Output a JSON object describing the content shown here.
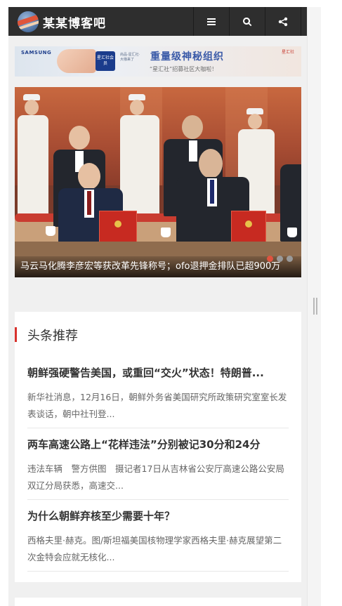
{
  "header": {
    "site_title": "某某博客吧",
    "buttons": [
      {
        "name": "menu",
        "icon": "menu-icon"
      },
      {
        "name": "search",
        "icon": "search-icon"
      },
      {
        "name": "share",
        "icon": "share-icon"
      }
    ]
  },
  "ad": {
    "brand": "SAMSUNG",
    "card_text": "星汇社会员",
    "small_text": "尚品·星汇社·大咖来了",
    "title": "重量级神秘组织",
    "subtitle": "“星汇社”招募社区大咖啦！",
    "logo_text": "星汇社"
  },
  "slider": {
    "caption": "马云马化腾李彦宏等获改革先锋称号；ofo退押金排队已超900万",
    "dots": [
      true,
      false,
      false
    ]
  },
  "headlines": {
    "section_title": "头条推荐",
    "items": [
      {
        "title": "朝鲜强硬警告美国，或重回“交火”状态！特朗普...",
        "desc": "新华社消息，12月16日，朝鲜外务省美国研究所政策研究室室长发表谈话，朝中社刊登..."
      },
      {
        "title": "两车高速公路上“花样违法”分别被记30分和24分",
        "desc": "违法车辆　警方供图　摄记者17日从吉林省公安厅高速公路公安局双辽分局获悉，高速交..."
      },
      {
        "title": "为什么朝鲜弃核至少需要十年？",
        "desc": "西格夫里·赫克。图/斯坦福美国核物理学家西格夫里·赫克展望第二次金特会应就无核化..."
      }
    ]
  },
  "colors": {
    "header_bg": "#2e2e2e",
    "accent_red": "#d8312c",
    "page_bg": "#f0f0f0"
  }
}
